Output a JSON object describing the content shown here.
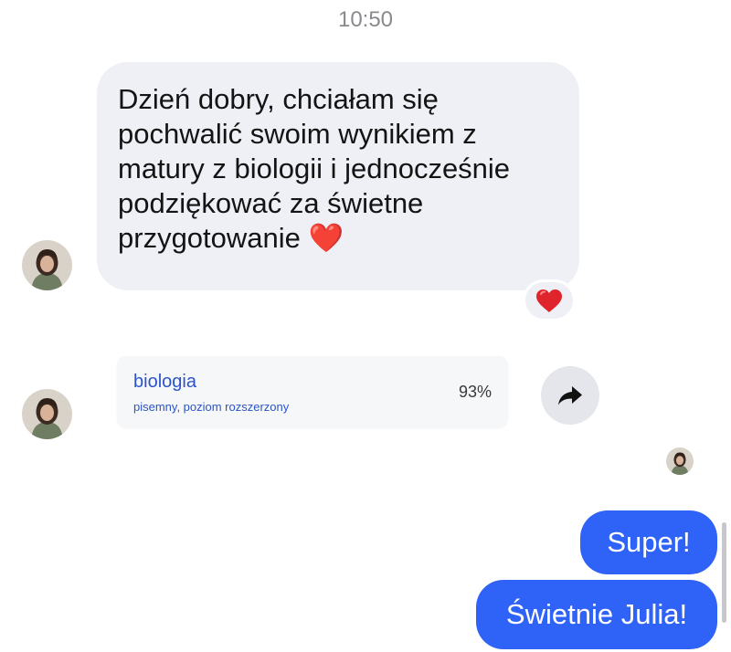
{
  "header": {
    "timestamp": "10:50"
  },
  "incoming_message": {
    "lines": [
      "Dzień dobry, chciałam się",
      "pochwalić swoim wynikiem z",
      "matury z biologii i jednocześnie",
      "podziękować za świetne",
      "przygotowanie ❤️"
    ],
    "reaction": "❤️"
  },
  "result_card": {
    "subject": "biologia",
    "details": "pisemny, poziom rozszerzony",
    "score": "93%"
  },
  "share_button": {
    "icon": "share-arrow-icon"
  },
  "outgoing_messages": [
    {
      "text": "Super!"
    },
    {
      "text": "Świetnie Julia!"
    }
  ],
  "colors": {
    "incoming_bubble": "#eef0f5",
    "outgoing_bubble": "#2f62f6",
    "card_text": "#2c54c9",
    "timestamp": "#8a8a8e"
  }
}
